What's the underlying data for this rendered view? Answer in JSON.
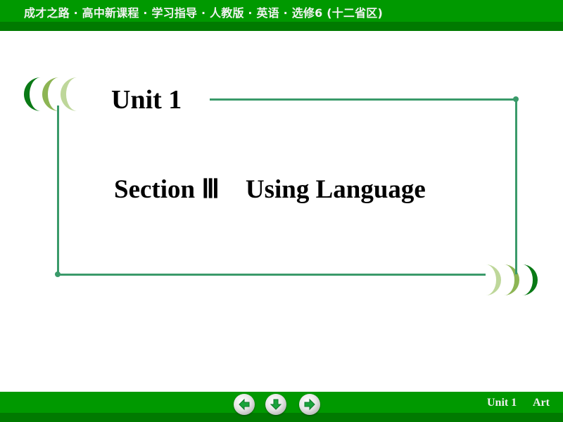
{
  "header": {
    "title": "成才之路 · 高中新课程 · 学习指导 · 人教版 · 英语 · 选修6 (十二省区)"
  },
  "slide": {
    "unit_title": "Unit 1",
    "section_title": "Section Ⅲ    Using Language"
  },
  "footer": {
    "nav": [
      {
        "icon": "arrow-left-icon",
        "label": "previous"
      },
      {
        "icon": "arrow-down-icon",
        "label": "home"
      },
      {
        "icon": "arrow-right-icon",
        "label": "next"
      }
    ],
    "unit_label": "Unit 1",
    "topic_label": "Art"
  },
  "colors": {
    "bar_green": "#009900",
    "bar_dark_green": "#007a00",
    "frame_line": "#3a9a6a",
    "crescent_dark": "#0a7a16",
    "crescent_mid": "#8db554",
    "crescent_light": "#bed79a"
  }
}
